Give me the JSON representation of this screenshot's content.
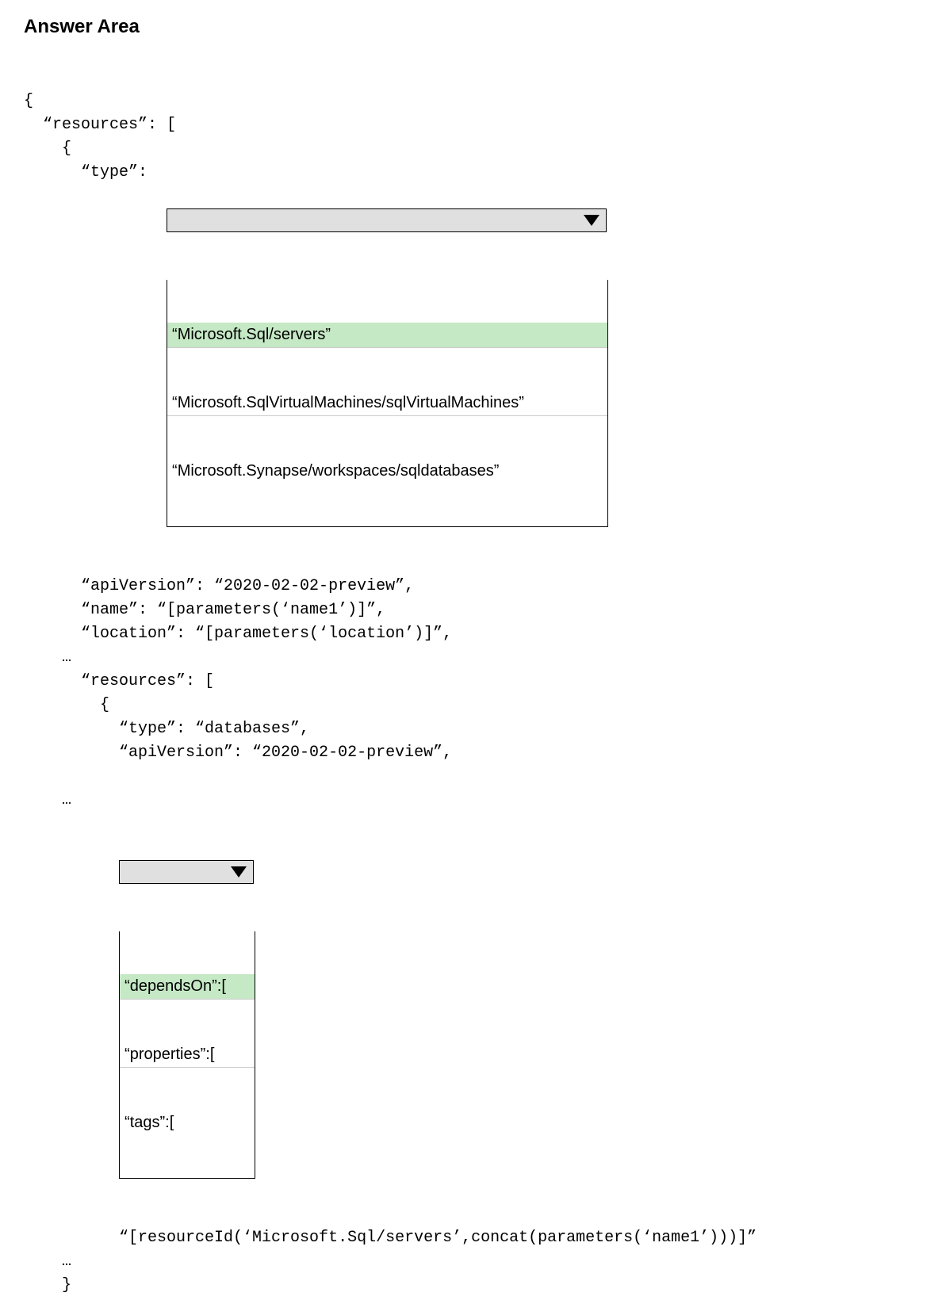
{
  "title": "Answer Area",
  "code": {
    "line1": "{",
    "line2": "  “resources”: [",
    "line3": "    {",
    "line4_prefix": "      “type”:  ",
    "line5": "      “apiVersion”: “2020-02-02-preview”,",
    "line6": "      “name”: “[parameters(‘name1’)]”,",
    "line7": "      “location”: “[parameters(‘location’)]”,",
    "line8": "    …",
    "line9": "      “resources”: [",
    "line10": "        {",
    "line11": "          “type”: “databases”,",
    "line12": "          “apiVersion”: “2020-02-02-preview”,",
    "line13": "",
    "line14": "    …",
    "line15_indent": "          ",
    "line16": "          “[resourceId(‘Microsoft.Sql/servers’,concat(parameters(‘name1’)))]”",
    "line17": "    …",
    "line18": "    }"
  },
  "dropdown1": {
    "options": [
      "“Microsoft.Sql/servers”",
      "“Microsoft.SqlVirtualMachines/sqlVirtualMachines”",
      "“Microsoft.Synapse/workspaces/sqldatabases”"
    ],
    "highlighted_index": 0
  },
  "dropdown2": {
    "options": [
      "“dependsOn”:[",
      "“properties”:[",
      "“tags”:["
    ],
    "highlighted_index": 0
  }
}
